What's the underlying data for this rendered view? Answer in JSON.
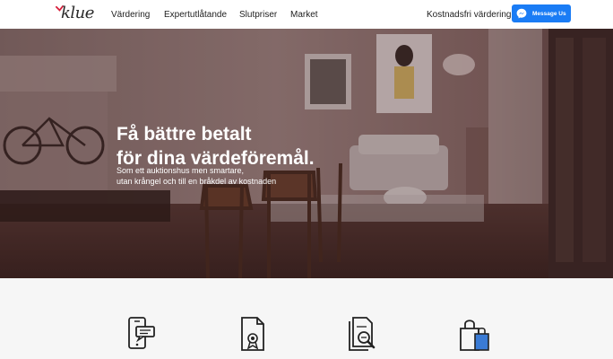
{
  "brand": {
    "logo_text": "klue"
  },
  "nav": {
    "links": [
      "Värdering",
      "Expertutlåtande",
      "Slutpriser",
      "Market"
    ],
    "cta": "Kostnadsfri värdering",
    "messenger_label": "Message Us"
  },
  "hero": {
    "title_lines": [
      "Få bättre betalt",
      "för dina värdeföremål."
    ],
    "subtitle_lines": [
      "Som ett auktionshus men smartare,",
      "utan krångel och till en bråkdel av kostnaden"
    ]
  },
  "features": {
    "icons": [
      "phone-chat-icon",
      "certificate-document-icon",
      "document-search-icon",
      "shopping-bag-icon"
    ]
  },
  "colors": {
    "accent_blue": "#1a7cf5",
    "logo_red": "#d81e3a",
    "features_bg": "#f6f6f6",
    "bag_blue": "#3a7bd5"
  }
}
